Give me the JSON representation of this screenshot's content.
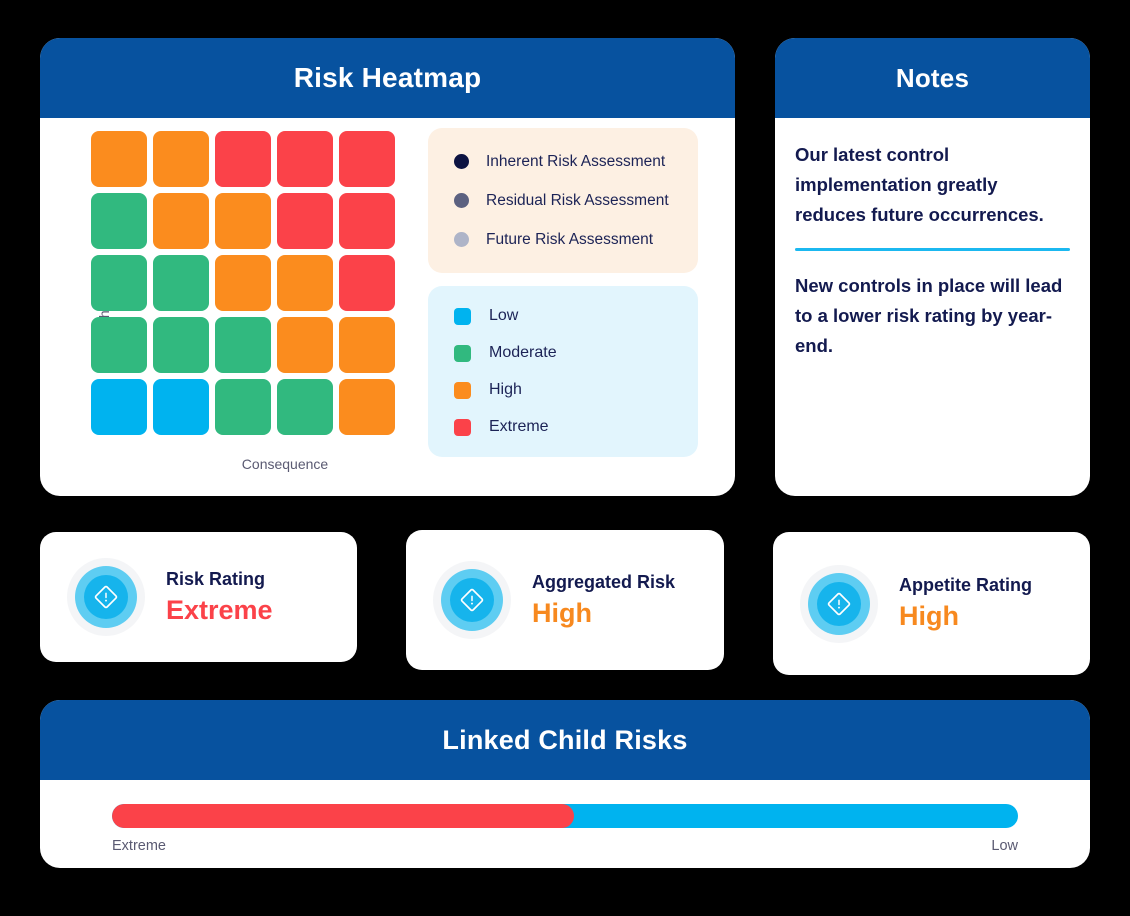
{
  "heatmap_panel": {
    "title": "Risk Heatmap",
    "y_axis_label": "Likelihood",
    "x_axis_label": "Consequence",
    "assessment_legend": [
      {
        "label": "Inherent Risk Assessment",
        "color": "#0d1342"
      },
      {
        "label": "Residual Risk Assessment",
        "color": "#5c6180"
      },
      {
        "label": "Future Risk Assessment",
        "color": "#aeb4c8"
      }
    ],
    "scale_legend": [
      {
        "label": "Low",
        "color": "#00b3ef"
      },
      {
        "label": "Moderate",
        "color": "#31b97f"
      },
      {
        "label": "High",
        "color": "#fb8c1e"
      },
      {
        "label": "Extreme",
        "color": "#fb4249"
      }
    ]
  },
  "chart_data": {
    "type": "heatmap",
    "title": "Risk Heatmap",
    "xlabel": "Consequence",
    "ylabel": "Likelihood",
    "rows": 5,
    "cols": 5,
    "legend_position": "right",
    "grid": false,
    "category_colors": {
      "Low": "#00b3ef",
      "Moderate": "#31b97f",
      "High": "#fb8c1e",
      "Extreme": "#fb4249"
    },
    "cells": [
      [
        "High",
        "High",
        "Extreme",
        "Extreme",
        "Extreme"
      ],
      [
        "Moderate",
        "High",
        "High",
        "Extreme",
        "Extreme"
      ],
      [
        "Moderate",
        "Moderate",
        "High",
        "High",
        "Extreme"
      ],
      [
        "Moderate",
        "Moderate",
        "Moderate",
        "High",
        "High"
      ],
      [
        "Low",
        "Low",
        "Moderate",
        "Moderate",
        "High"
      ]
    ]
  },
  "notes_panel": {
    "title": "Notes",
    "paragraph_1": "Our latest control implementation greatly reduces future occurrences.",
    "paragraph_2": "New controls in place will lead to a lower risk rating by year-end."
  },
  "rating_cards": [
    {
      "title": "Risk Rating",
      "value": "Extreme",
      "value_color": "#fb4249",
      "icon": "alert-diamond-icon"
    },
    {
      "title": "Aggregated Risk",
      "value": "High",
      "value_color": "#f7891f",
      "icon": "alert-diamond-icon"
    },
    {
      "title": "Appetite Rating",
      "value": "High",
      "value_color": "#f7891f",
      "icon": "alert-diamond-icon"
    }
  ],
  "linked_risks_panel": {
    "title": "Linked Child Risks",
    "bar": {
      "left_label": "Extreme",
      "right_label": "Low",
      "extreme_percent": 51,
      "low_percent": 49,
      "extreme_color": "#fb4249",
      "low_color": "#00b3ef"
    }
  }
}
